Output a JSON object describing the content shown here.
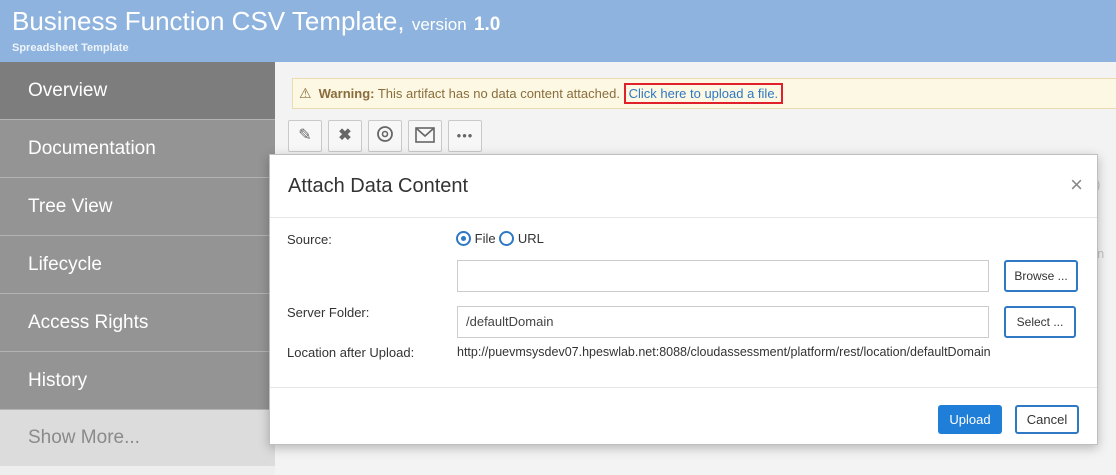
{
  "header": {
    "title": "Business Function CSV Template,",
    "version_label": "version",
    "version_number": "1.0",
    "subtitle": "Spreadsheet Template"
  },
  "sidebar": {
    "items": [
      {
        "label": "Overview"
      },
      {
        "label": "Documentation"
      },
      {
        "label": "Tree View"
      },
      {
        "label": "Lifecycle"
      },
      {
        "label": "Access Rights"
      },
      {
        "label": "History"
      },
      {
        "label": "Show More..."
      }
    ]
  },
  "warning": {
    "prefix": "Warning:",
    "text": " This artifact has no data content attached.",
    "link": "Click here to upload a file."
  },
  "toolbar": {
    "icons": [
      "pencil-icon",
      "close-icon",
      "compass-icon",
      "envelope-icon",
      "more-icon"
    ]
  },
  "background": {
    "fragment_a": ")",
    "fragment_b": "n"
  },
  "modal": {
    "title": "Attach Data Content",
    "close_glyph": "×",
    "source_label": "Source:",
    "file_option": "File",
    "url_option": "URL",
    "file_value": "",
    "browse_label": "Browse ...",
    "server_folder_label": "Server Folder:",
    "server_folder_value": "/defaultDomain",
    "select_label": "Select ...",
    "location_label": "Location after Upload:",
    "location_value": "http://puevmsysdev07.hpeswlab.net:8088/cloudassessment/platform/rest/location/defaultDomain",
    "upload_label": "Upload",
    "cancel_label": "Cancel"
  },
  "colors": {
    "header": "#8db3de",
    "accent": "#2f78c4",
    "warning_bg": "#fcf8e3",
    "highlight": "#e0202a"
  }
}
